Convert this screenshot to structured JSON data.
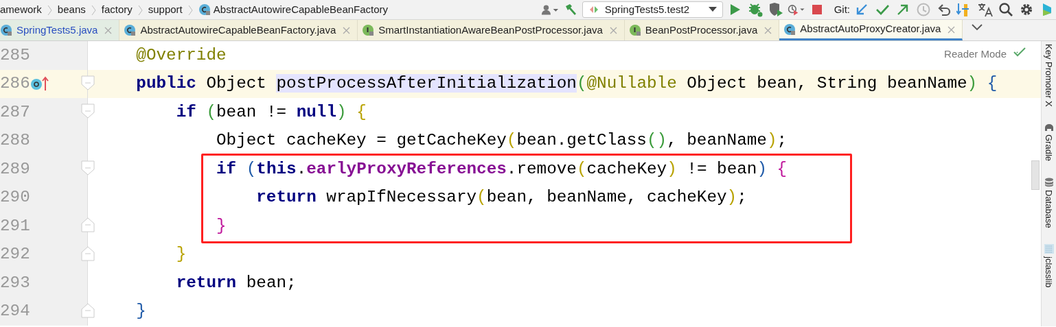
{
  "breadcrumbs": [
    {
      "label": "amework",
      "kind": "package"
    },
    {
      "label": "beans",
      "kind": "package"
    },
    {
      "label": "factory",
      "kind": "package"
    },
    {
      "label": "support",
      "kind": "package"
    },
    {
      "label": "AbstractAutowireCapableBeanFactory",
      "kind": "class"
    }
  ],
  "toolbar": {
    "run_config": "SpringTests5.test2",
    "git_label": "Git:"
  },
  "tabs": [
    {
      "label": "SpringTests5.java",
      "kind": "class",
      "selected": false,
      "modified": true
    },
    {
      "label": "AbstractAutowireCapableBeanFactory.java",
      "kind": "class",
      "selected": false,
      "modified": false
    },
    {
      "label": "SmartInstantiationAwareBeanPostProcessor.java",
      "kind": "interface",
      "selected": false,
      "modified": false
    },
    {
      "label": "BeanPostProcessor.java",
      "kind": "interface",
      "selected": false,
      "modified": false
    },
    {
      "label": "AbstractAutoProxyCreator.java",
      "kind": "class",
      "selected": true,
      "modified": false
    }
  ],
  "editor": {
    "reader_mode": "Reader Mode",
    "lines": [
      {
        "number": "285",
        "current": false,
        "override_marker": false,
        "fold_open": false,
        "fold_close": false,
        "boxed": false,
        "tokens": [
          {
            "text": "    @Override",
            "kind": "annotation"
          }
        ]
      },
      {
        "number": "286",
        "current": true,
        "override_marker": true,
        "fold_open": true,
        "fold_close": false,
        "boxed": false,
        "tokens": [
          {
            "text": "    public ",
            "kind": "keyword"
          },
          {
            "text": "Object ",
            "kind": "plain"
          },
          {
            "text": "postProcessAfterInitialization",
            "kind": "match"
          },
          {
            "text": "(",
            "kind": "paren-a"
          },
          {
            "text": "@Nullable ",
            "kind": "annotation"
          },
          {
            "text": "Object bean, String beanName",
            "kind": "plain"
          },
          {
            "text": ")",
            "kind": "paren-a"
          },
          {
            "text": " {",
            "kind": "paren-d"
          }
        ]
      },
      {
        "number": "287",
        "current": false,
        "override_marker": false,
        "fold_open": true,
        "fold_close": false,
        "boxed": false,
        "tokens": [
          {
            "text": "        if ",
            "kind": "keyword"
          },
          {
            "text": "(",
            "kind": "paren-a"
          },
          {
            "text": "bean != ",
            "kind": "plain"
          },
          {
            "text": "null",
            "kind": "keyword"
          },
          {
            "text": ")",
            "kind": "paren-a"
          },
          {
            "text": " {",
            "kind": "paren-b"
          }
        ]
      },
      {
        "number": "288",
        "current": false,
        "override_marker": false,
        "fold_open": false,
        "fold_close": false,
        "boxed": false,
        "tokens": [
          {
            "text": "            Object cacheKey = getCacheKey",
            "kind": "plain"
          },
          {
            "text": "(",
            "kind": "paren-b"
          },
          {
            "text": "bean.getClass",
            "kind": "plain"
          },
          {
            "text": "()",
            "kind": "paren-a"
          },
          {
            "text": ", beanName",
            "kind": "plain"
          },
          {
            "text": ")",
            "kind": "paren-b"
          },
          {
            "text": ";",
            "kind": "plain"
          }
        ]
      },
      {
        "number": "289",
        "current": false,
        "override_marker": false,
        "fold_open": true,
        "fold_close": false,
        "boxed": true,
        "tokens": [
          {
            "text": "            if ",
            "kind": "keyword"
          },
          {
            "text": "(",
            "kind": "paren-d"
          },
          {
            "text": "this",
            "kind": "keyword"
          },
          {
            "text": ".",
            "kind": "plain"
          },
          {
            "text": "earlyProxyReferences",
            "kind": "field"
          },
          {
            "text": ".remove",
            "kind": "plain"
          },
          {
            "text": "(",
            "kind": "paren-b"
          },
          {
            "text": "cacheKey",
            "kind": "plain"
          },
          {
            "text": ")",
            "kind": "paren-b"
          },
          {
            "text": " != bean",
            "kind": "plain"
          },
          {
            "text": ")",
            "kind": "paren-d"
          },
          {
            "text": " {",
            "kind": "paren-c"
          }
        ]
      },
      {
        "number": "290",
        "current": false,
        "override_marker": false,
        "fold_open": false,
        "fold_close": false,
        "boxed": true,
        "tokens": [
          {
            "text": "                return ",
            "kind": "keyword"
          },
          {
            "text": "wrapIfNecessary",
            "kind": "plain"
          },
          {
            "text": "(",
            "kind": "paren-b"
          },
          {
            "text": "bean, beanName, cacheKey",
            "kind": "plain"
          },
          {
            "text": ")",
            "kind": "paren-b"
          },
          {
            "text": ";",
            "kind": "plain"
          }
        ]
      },
      {
        "number": "291",
        "current": false,
        "override_marker": false,
        "fold_open": false,
        "fold_close": true,
        "boxed": true,
        "tokens": [
          {
            "text": "            }",
            "kind": "paren-c"
          }
        ]
      },
      {
        "number": "292",
        "current": false,
        "override_marker": false,
        "fold_open": false,
        "fold_close": true,
        "boxed": false,
        "tokens": [
          {
            "text": "        }",
            "kind": "paren-b"
          }
        ]
      },
      {
        "number": "293",
        "current": false,
        "override_marker": false,
        "fold_open": false,
        "fold_close": false,
        "boxed": false,
        "tokens": [
          {
            "text": "        return ",
            "kind": "keyword"
          },
          {
            "text": "bean;",
            "kind": "plain"
          }
        ]
      },
      {
        "number": "294",
        "current": false,
        "override_marker": false,
        "fold_open": false,
        "fold_close": true,
        "boxed": false,
        "tokens": [
          {
            "text": "    }",
            "kind": "paren-d"
          }
        ]
      }
    ]
  },
  "tool_windows": [
    {
      "label": "Key Promoter X",
      "kind": "plain"
    },
    {
      "label": "Gradle",
      "kind": "gradle"
    },
    {
      "label": "Database",
      "kind": "database"
    },
    {
      "label": "jclasslib",
      "kind": "jclasslib"
    }
  ]
}
